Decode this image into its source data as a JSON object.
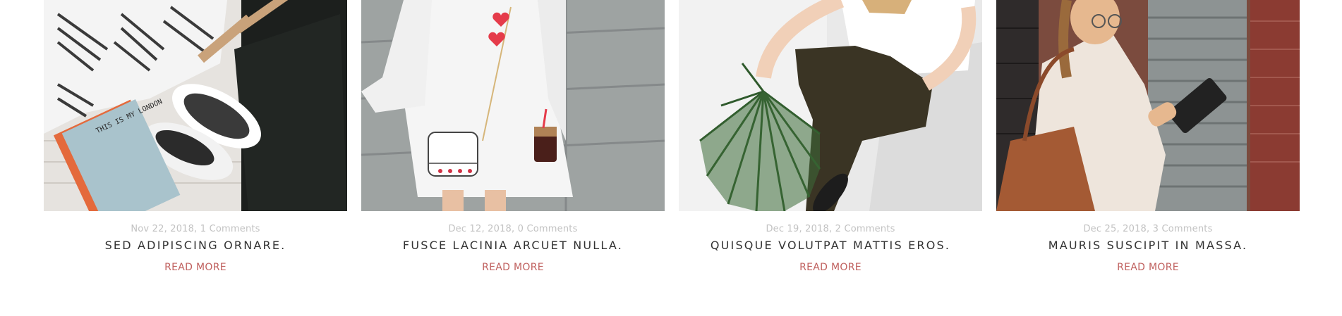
{
  "posts": [
    {
      "image": "flatlay-clothes-book-sneakers",
      "image_text": "THIS IS MY LONDON",
      "meta": "Nov 22, 2018, 1 Comments",
      "title": "Sed adipiscing ornare.",
      "read_more": "READ MORE"
    },
    {
      "image": "woman-white-dress-handbag",
      "meta": "Dec 12, 2018, 0 Comments",
      "title": "Fusce lacinia arcuet nulla.",
      "read_more": "READ MORE"
    },
    {
      "image": "woman-palm-leaf-dark-trousers",
      "meta": "Dec 19, 2018, 2 Comments",
      "title": "Quisque volutpat mattis eros.",
      "read_more": "READ MORE"
    },
    {
      "image": "woman-tablet-brick-wall",
      "meta": "Dec 25, 2018, 3 Comments",
      "title": "Mauris suscipit in massa.",
      "read_more": "READ MORE"
    }
  ],
  "colors": {
    "meta": "#c2c2c2",
    "title": "#333333",
    "accent": "#c0615f"
  }
}
